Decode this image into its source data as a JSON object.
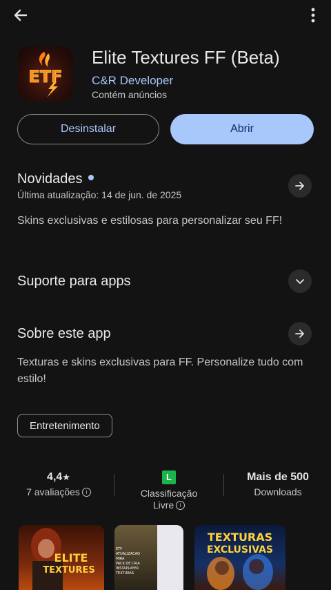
{
  "app": {
    "title": "Elite Textures FF (Beta)",
    "developer": "C&R Developer",
    "ads_notice": "Contém anúncios",
    "icon_text": "ETF"
  },
  "actions": {
    "uninstall_label": "Desinstalar",
    "open_label": "Abrir"
  },
  "whats_new": {
    "title": "Novidades",
    "updated": "Última atualização: 14 de jun. de 2025",
    "body": "Skins exclusivas e estilosas para personalizar seu FF!"
  },
  "support": {
    "title": "Suporte para apps"
  },
  "about": {
    "title": "Sobre este app",
    "body": "Texturas e skins exclusivas para FF. Personalize tudo com estilo!",
    "category": "Entretenimento"
  },
  "stats": {
    "rating_value": "4,4",
    "rating_star": "★",
    "rating_count": "7 avaliações",
    "content_rating_badge": "L",
    "content_rating_label": "Classificação",
    "content_rating_value": "Livre",
    "downloads_value": "Mais de 500",
    "downloads_label": "Downloads"
  },
  "screenshots": {
    "shot1_line1": "ELITE",
    "shot1_line2": "TEXTURES",
    "shot3_line1": "TEXTURAS",
    "shot3_line2": "EXCLUSIVAS",
    "shot2_menu": [
      "ETF",
      "ATUALIZACAO",
      "MIRA",
      "PACK DE CRIA",
      "INSTAPLAYER",
      "TEXTURAS"
    ]
  },
  "colors": {
    "background": "#131313",
    "accent": "#a8c7fa",
    "open_button_text": "#062e6f",
    "rating_badge": "#1bb34a"
  }
}
